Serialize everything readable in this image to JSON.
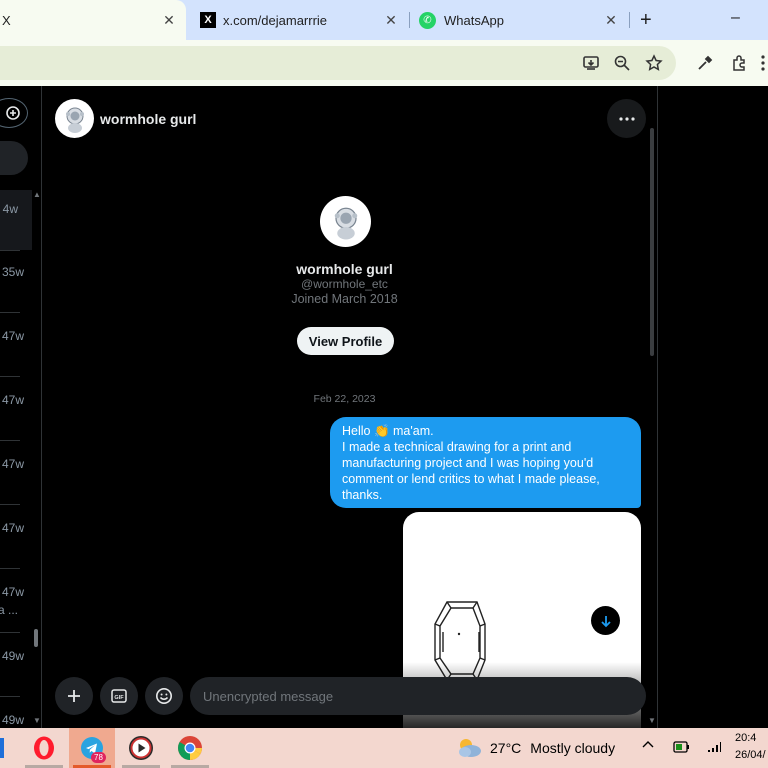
{
  "browser": {
    "tabs": [
      {
        "title": "X",
        "active": true
      },
      {
        "title": "x.com/dejamarrrie",
        "active": false
      },
      {
        "title": "WhatsApp",
        "active": false
      }
    ],
    "new_tab_label": "+",
    "minimize_label": "–",
    "close_glyph": "✕"
  },
  "sidebar": {
    "conversations": [
      {
        "time": "4w"
      },
      {
        "time": "35w"
      },
      {
        "time": "47w"
      },
      {
        "time": "47w"
      },
      {
        "time": "47w"
      },
      {
        "time": "47w"
      },
      {
        "time": "47w",
        "snippet": "a ..."
      },
      {
        "time": "49w"
      },
      {
        "time": "49w"
      }
    ]
  },
  "chat": {
    "header_name": "wormhole gurl",
    "profile": {
      "name": "wormhole gurl",
      "handle": "@wormhole_etc",
      "joined": "Joined March 2018",
      "view_profile": "View Profile"
    },
    "date_divider": "Feb 22, 2023",
    "message": {
      "line1": "Hello 👏 ma'am.",
      "body": "I made a technical drawing for a print and manufacturing project and I was hoping you'd comment or lend critics to what I made please, thanks."
    },
    "composer": {
      "placeholder": "Unencrypted message"
    }
  },
  "taskbar": {
    "temperature": "27°C",
    "weather": "Mostly cloudy",
    "telegram_badge": "78",
    "time": "20:4",
    "date": "26/04/"
  },
  "colors": {
    "accent": "#1d9bf0",
    "background": "#000000",
    "taskbar": "#f3d7cf"
  }
}
